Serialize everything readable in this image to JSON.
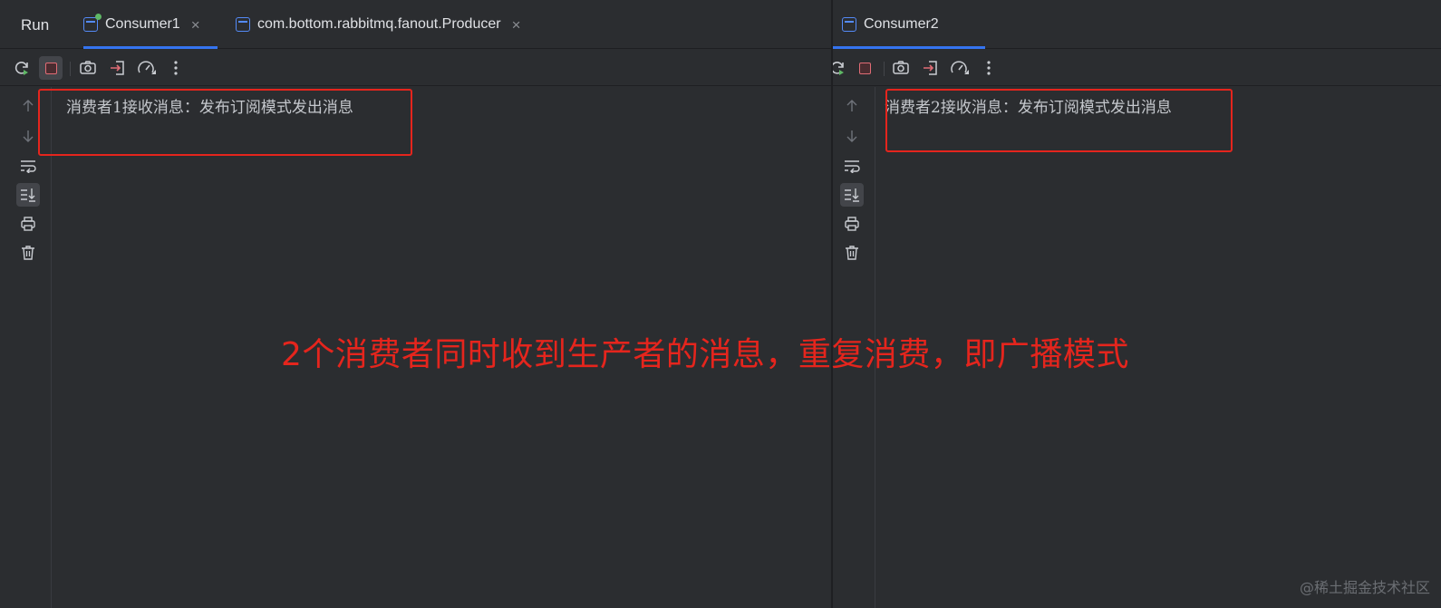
{
  "window": {
    "run_label": "Run"
  },
  "left_pane": {
    "tabs": [
      {
        "label": "Consumer1",
        "active": true,
        "close": "×"
      },
      {
        "label": "com.bottom.rabbitmq.fanout.Producer",
        "active": false,
        "close": "×"
      }
    ],
    "toolbar": [
      "rerun-icon",
      "stop-icon",
      "screenshot-icon",
      "exit-icon",
      "profiler-icon",
      "more-icon"
    ],
    "side_toolbar": [
      "up-arrow-icon",
      "down-arrow-icon",
      "soft-wrap-icon",
      "scroll-to-end-icon",
      "print-icon",
      "trash-icon"
    ],
    "console_output": "消费者1接收消息：发布订阅模式发出消息"
  },
  "right_pane": {
    "tabs": [
      {
        "label": "Consumer2",
        "active": true
      }
    ],
    "console_output": "消费者2接收消息：发布订阅模式发出消息"
  },
  "annotation": {
    "text": "2个消费者同时收到生产者的消息，重复消费，即广播模式",
    "color": "#e5251d"
  },
  "watermark": "@稀土掘金技术社区",
  "colors": {
    "background": "#2b2d30",
    "accent": "#3574f0",
    "highlight": "#e5251d",
    "stop": "#e06c75",
    "running_dot": "#5fb865"
  }
}
